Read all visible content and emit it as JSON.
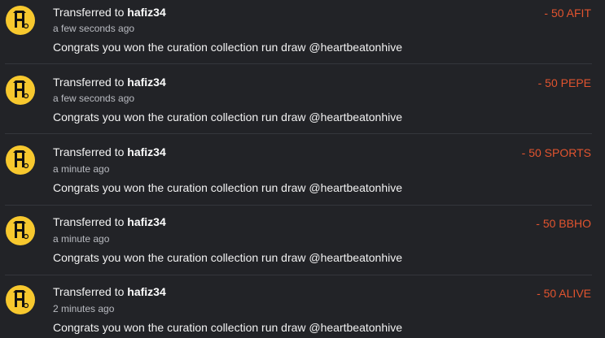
{
  "transfers": [
    {
      "prefix": "Transferred to",
      "user": "hafiz34",
      "time": "a few seconds ago",
      "memo": "Congrats you won the curation collection run draw @heartbeatonhive",
      "amount": "- 50 AFIT"
    },
    {
      "prefix": "Transferred to",
      "user": "hafiz34",
      "time": "a few seconds ago",
      "memo": "Congrats you won the curation collection run draw @heartbeatonhive",
      "amount": "- 50 PEPE"
    },
    {
      "prefix": "Transferred to",
      "user": "hafiz34",
      "time": "a minute ago",
      "memo": "Congrats you won the curation collection run draw @heartbeatonhive",
      "amount": "- 50 SPORTS"
    },
    {
      "prefix": "Transferred to",
      "user": "hafiz34",
      "time": "a minute ago",
      "memo": "Congrats you won the curation collection run draw @heartbeatonhive",
      "amount": "- 50 BBHO"
    },
    {
      "prefix": "Transferred to",
      "user": "hafiz34",
      "time": "2 minutes ago",
      "memo": "Congrats you won the curation collection run draw @heartbeatonhive",
      "amount": "- 50 ALIVE"
    }
  ],
  "colors": {
    "background": "#222327",
    "amount": "#e2542f",
    "avatar": "#f7c82e"
  },
  "icons": {
    "avatar": "heartbeat-logo-icon"
  }
}
